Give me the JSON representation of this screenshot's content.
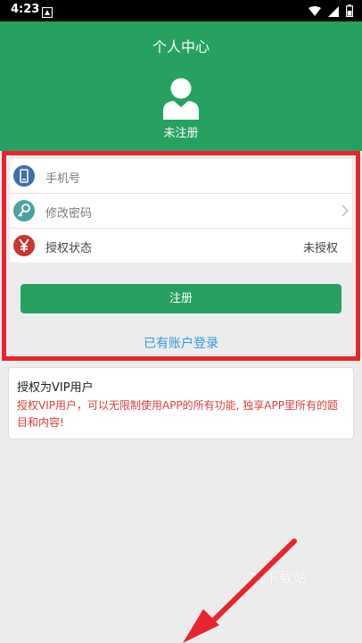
{
  "status_bar": {
    "time": "4:23"
  },
  "header": {
    "title": "个人中心",
    "registration_status": "未注册"
  },
  "form": {
    "phone_placeholder": "手机号",
    "change_password_label": "修改密码",
    "auth_status_label": "授权状态",
    "auth_status_value": "未授权"
  },
  "actions": {
    "register_button": "注册",
    "login_link": "已有账户登录"
  },
  "vip_card": {
    "title": "授权为VIP用户",
    "description": "授权VIP用户，可以无限制使用APP的所有功能, 独享APP里所有的题目和内容!"
  },
  "watermark": "78下载站",
  "colors": {
    "primary_green": "#26a160",
    "highlight_red": "#e8252e",
    "link_blue": "#2f9ad6",
    "warning_red": "#d9403b"
  },
  "icons": {
    "phone": "phone-icon",
    "key": "key-icon",
    "yen": "yen-icon",
    "avatar": "user-avatar-icon",
    "chevron": "chevron-right-icon"
  }
}
